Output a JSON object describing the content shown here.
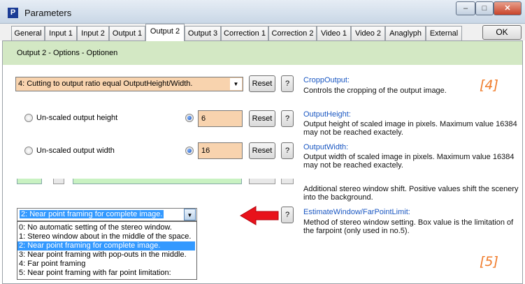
{
  "window": {
    "title": "Parameters",
    "icon_letter": "P",
    "min": "–",
    "max": "□",
    "close": "✕"
  },
  "tabs": [
    "General",
    "Input 1",
    "Input 2",
    "Output 1",
    "Output 2",
    "Output 3",
    "Correction 1",
    "Correction 2",
    "Video 1",
    "Video 2",
    "Anaglyph",
    "External"
  ],
  "active_tab": "Output 2",
  "ok_label": "OK",
  "section_title": "Output 2 - Options - Optionen",
  "crop": {
    "value": "4: Cutting to output ratio equal OutputHeight/Width.",
    "reset": "Reset",
    "help": "?",
    "title": "CroppOutput:",
    "desc": "Controls the cropping of the output image."
  },
  "height": {
    "label": "Un-scaled output height",
    "value": "6",
    "reset": "Reset",
    "help": "?",
    "title": "OutputHeight:",
    "desc1": "Output height of scaled image in pixels. Maximum value 16384",
    "desc2": "may not be reached exactely."
  },
  "width": {
    "label": "Un-scaled output width",
    "value": "16",
    "reset": "Reset",
    "help": "?",
    "title": "OutputWidth:",
    "desc1": "Output width of scaled image in pixels. Maximum value 16384",
    "desc2": "may not be reached exactely."
  },
  "shift": {
    "desc1": "Additional stereo window shift. Positive values shift the scenery",
    "desc2": "into the background."
  },
  "estimate": {
    "selected": "2: Near point framing for complete image.",
    "help": "?",
    "title": "EstimateWindow/FarPointLimit:",
    "desc1": "Method of stereo window setting. Box value is the limitation of",
    "desc2": "the farpoint (only used in no.5).",
    "options": [
      "0: No automatic setting of the stereo window.",
      "1: Stereo window about in the middle of the space.",
      "2: Near point framing for complete image.",
      "3: Near point framing with pop-outs in the middle.",
      "4: Far point framing",
      "5: Near point framing with far point limitation:"
    ]
  },
  "markers": {
    "top": "[4]",
    "bottom": "[5]"
  },
  "colors": {
    "arrow": "#e8121b",
    "marker": "#f07b2a",
    "header_bg": "#d3e8c4",
    "field_bg": "#f8d3ae",
    "link": "#1a57c2"
  }
}
